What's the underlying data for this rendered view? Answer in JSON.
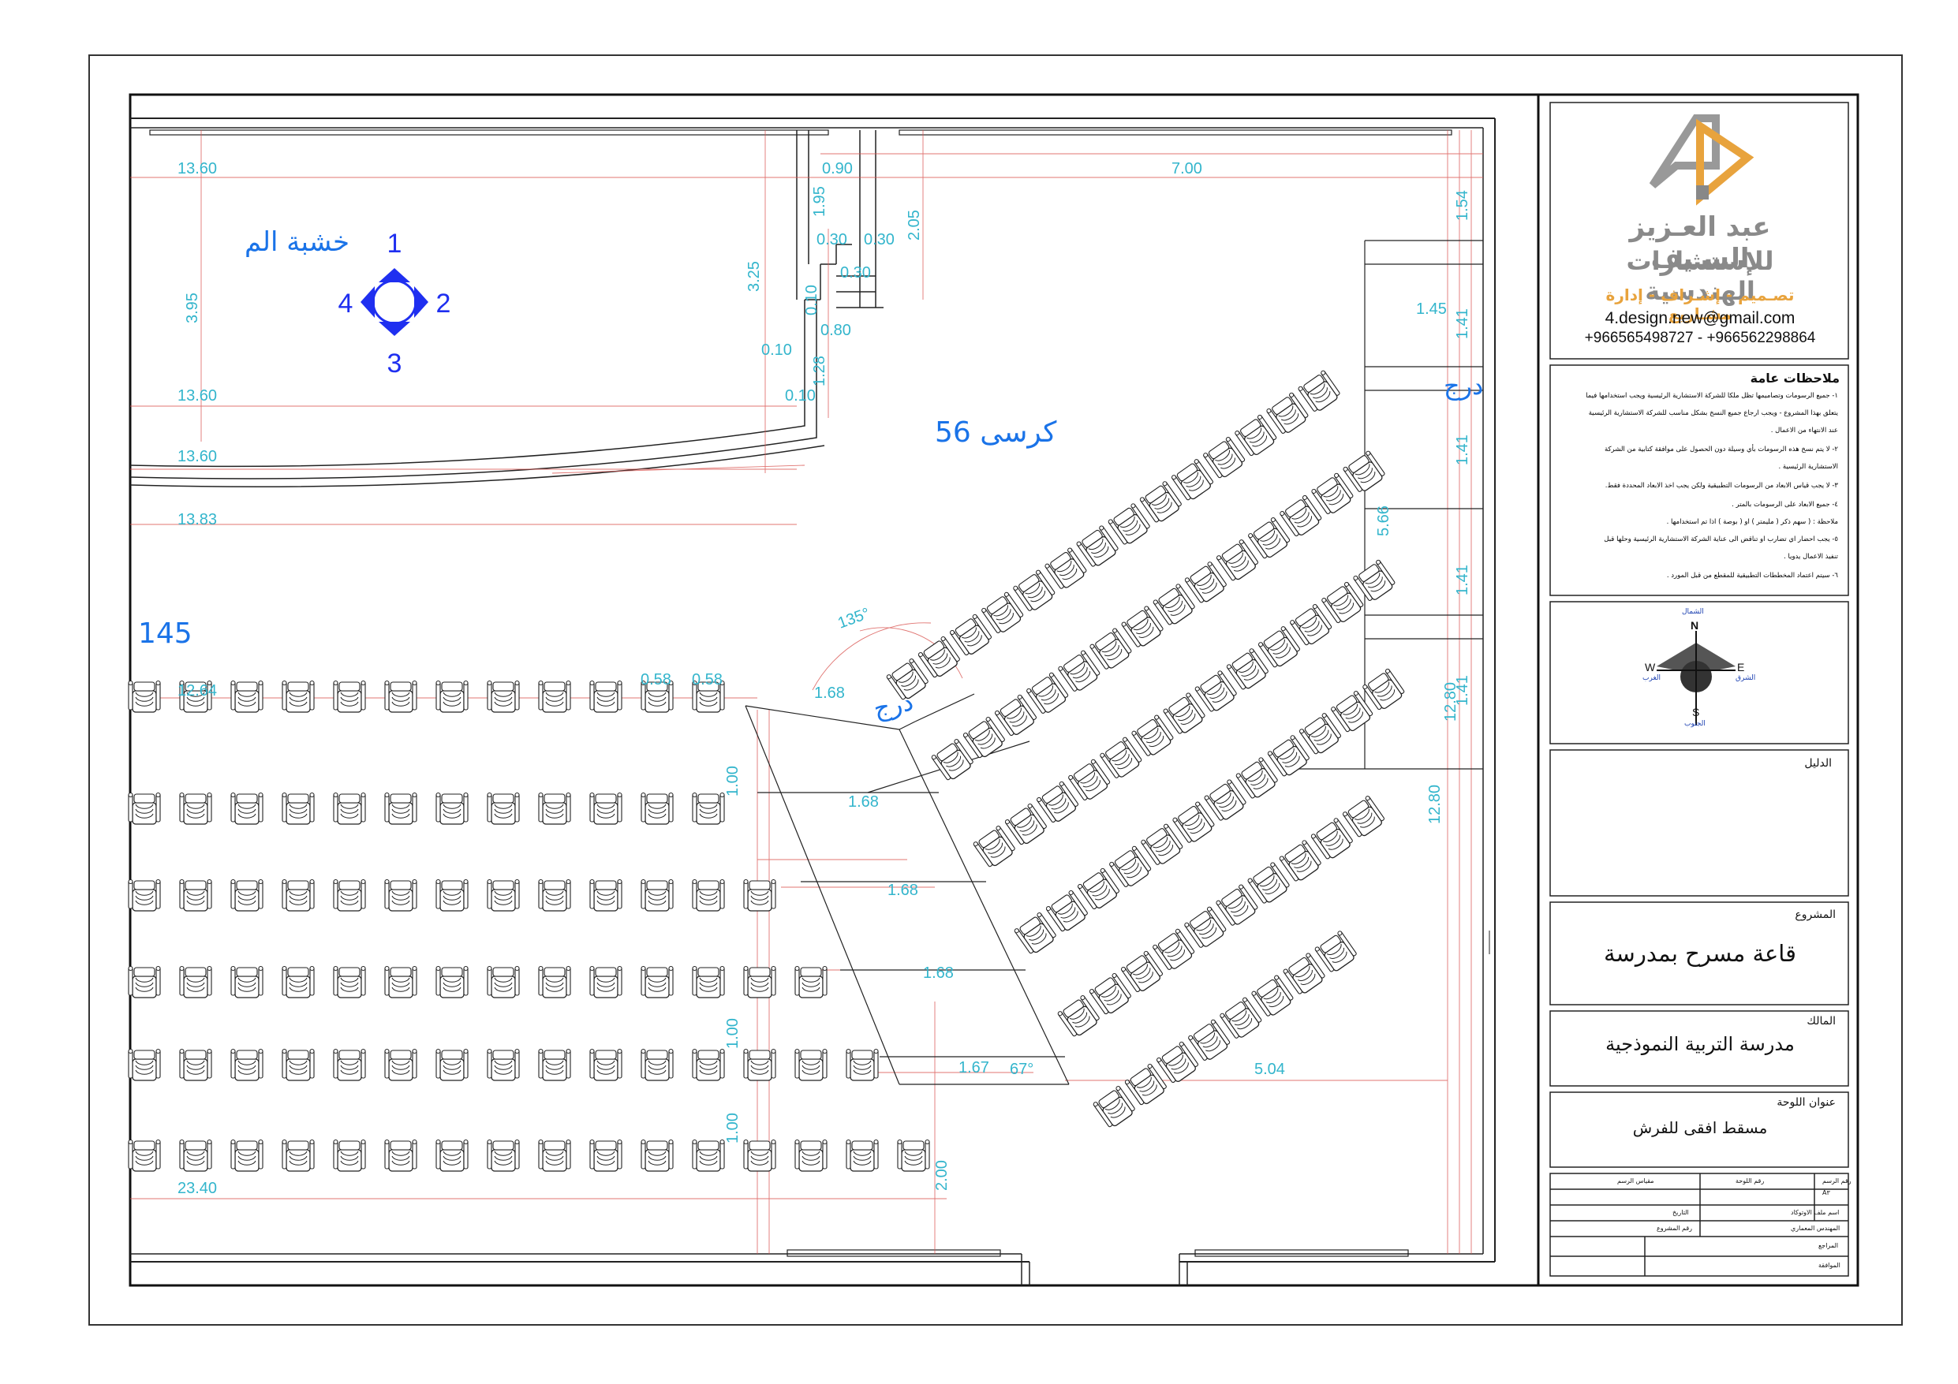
{
  "drawing": {
    "hall_seat_count_label": "56 كرسى",
    "stage_label": "خشبة الم",
    "stairs_label": "درج",
    "angle_label": "135°",
    "angle_small_label": "67°",
    "partial_label": "145",
    "view_marker": {
      "top": "1",
      "right": "2",
      "bottom": "3",
      "left": "4"
    },
    "dimensions": {
      "d_13_60_a": "13.60",
      "d_0_90": "0.90",
      "d_7_00": "7.00",
      "d_1_54": "1.54",
      "d_1_95": "1.95",
      "d_2_05": "2.05",
      "d_0_30_a": "0.30",
      "d_0_30_b": "0.30",
      "d_0_30_c": "0.30",
      "d_3_25": "3.25",
      "d_3_95": "3.95",
      "d_0_10_a": "0.10",
      "d_0_80": "0.80",
      "d_0_10_b": "0.10",
      "d_1_28": "1.28",
      "d_0_10_c": "0.10",
      "d_13_60_b": "13.60",
      "d_13_60_c": "13.60",
      "d_13_83": "13.83",
      "d_1_45": "1.45",
      "d_1_41_a": "1.41",
      "d_1_41_b": "1.41",
      "d_5_66": "5.66",
      "d_1_41_c": "1.41",
      "d_1_41_d": "1.41",
      "d_12_80_a": "12.80",
      "d_12_80_b": "12.80",
      "d_12_64": "12.64",
      "d_0_58_a": "0.58",
      "d_0_58_b": "0.58",
      "d_1_68_a": "1.68",
      "d_1_68_b": "1.68",
      "d_1_68_c": "1.68",
      "d_1_68_d": "1.68",
      "d_1_67": "1.67",
      "d_5_04": "5.04",
      "d_2_00": "2.00",
      "d_23_40": "23.40",
      "d_1_00_a": "1.00",
      "d_1_00_b": "1.00",
      "d_1_00_c": "1.00"
    }
  },
  "title_block": {
    "company_name": "عبد العـزيز السـيف",
    "company_sub": "للإستشارات الهندسية",
    "tagline": "تصـميم - إشـراف - إدارة مشـاريع",
    "email": "4.design.new@gmail.com",
    "phones": "+966565498727 - +966562298864",
    "notes_title": "ملاحظات عامة",
    "notes": [
      "١- جميع الرسومات وتصاميمها تظل ملكا للشركة الاستشارية الرئيسية ويجب استخدامها فيما",
      "يتعلق بهذا المشروع - ويجب ارجاع جميع النسخ بشكل مناسب للشركة الاستشارية الرئيسية",
      "عند الانتهاء من الاعمال .",
      "٢- لا يتم نسخ هذه الرسومات بأي وسيلة دون الحصول على موافقة كتابية من الشركة",
      "الاستشارية الرئيسية .",
      "٣- لا يجب قياس الابعاد من الرسومات التطبيقية ولكن يجب اخذ الابعاد المحددة فقط.",
      "٤- جميع الابعاد على الرسومات بالمتر .",
      "ملاحظة : ( سهم ذكر ( مليمتر ) او ( بوصة ) اذا تم استخدامها .",
      "٥- يجب احضار اي تضارب او تناقض الى عناية الشركة الاستشارية الرئيسية وحلها قبل",
      "تنفيذ الاعمال يدويا .",
      "٦- سيتم اعتماد المخططات التطبيقية للمقطع من قبل المورد ."
    ],
    "compass": {
      "n": "N",
      "s": "S",
      "e": "E",
      "w": "W",
      "n_ar": "الشمال",
      "s_ar": "الجنوب",
      "e_ar": "الشرق",
      "w_ar": "الغرب"
    },
    "legend_label": "الدليل",
    "project_label": "المشروع",
    "project_value": "قاعة مسرح بمدرسة",
    "owner_label": "المالك",
    "owner_value": "مدرسة التربية النموذجية",
    "sheet_title_label": "عنوان اللوحة",
    "sheet_title_value": "مسقط افقى للفرش",
    "table": {
      "sheet_no": "رقم اللوحة",
      "drawing_scale": "مقياس الرسم",
      "drawing_no": "رقم الرسم",
      "date": "التاريخ",
      "project_no": "رقم المشروع",
      "file_name": "اسم ملف الاوتوكاد",
      "architect": "المهندس المعماري",
      "reviewer": "المراجع",
      "approval": "الموافقة",
      "sheet_value": "A٣"
    }
  }
}
